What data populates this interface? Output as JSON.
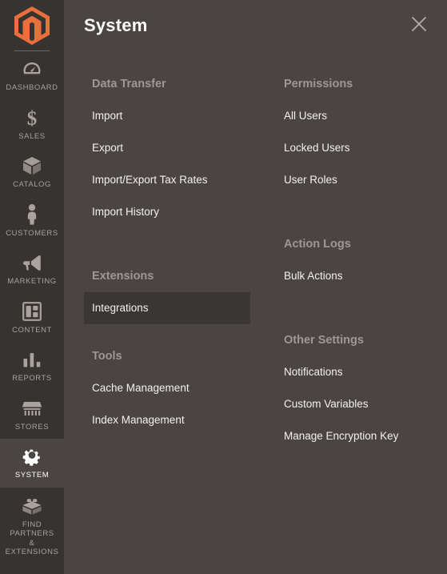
{
  "brand": {
    "logo_icon": "magento-logo-icon",
    "logo_color": "#e9703e"
  },
  "sidebar": {
    "items": [
      {
        "label": "DASHBOARD",
        "icon": "dashboard-gauge-icon",
        "active": false
      },
      {
        "label": "SALES",
        "icon": "dollar-sign-icon",
        "active": false
      },
      {
        "label": "CATALOG",
        "icon": "box-icon",
        "active": false
      },
      {
        "label": "CUSTOMERS",
        "icon": "person-icon",
        "active": false
      },
      {
        "label": "MARKETING",
        "icon": "megaphone-icon",
        "active": false
      },
      {
        "label": "CONTENT",
        "icon": "layout-page-icon",
        "active": false
      },
      {
        "label": "REPORTS",
        "icon": "bar-chart-icon",
        "active": false
      },
      {
        "label": "STORES",
        "icon": "storefront-icon",
        "active": false
      },
      {
        "label": "SYSTEM",
        "icon": "gear-icon",
        "active": true
      },
      {
        "label": "FIND PARTNERS\n& EXTENSIONS",
        "icon": "lego-brick-icon",
        "active": false
      }
    ]
  },
  "panel": {
    "title": "System",
    "close_icon": "close-x-icon",
    "columns": {
      "left": [
        {
          "title": "Data Transfer",
          "items": [
            {
              "label": "Import",
              "highlighted": false
            },
            {
              "label": "Export",
              "highlighted": false
            },
            {
              "label": "Import/Export Tax Rates",
              "highlighted": false
            },
            {
              "label": "Import History",
              "highlighted": false
            }
          ]
        },
        {
          "title": "Extensions",
          "items": [
            {
              "label": "Integrations",
              "highlighted": true
            }
          ]
        },
        {
          "title": "Tools",
          "items": [
            {
              "label": "Cache Management",
              "highlighted": false
            },
            {
              "label": "Index Management",
              "highlighted": false
            }
          ]
        }
      ],
      "right": [
        {
          "title": "Permissions",
          "items": [
            {
              "label": "All Users",
              "highlighted": false
            },
            {
              "label": "Locked Users",
              "highlighted": false
            },
            {
              "label": "User Roles",
              "highlighted": false
            }
          ]
        },
        {
          "title": "Action Logs",
          "items": [
            {
              "label": "Bulk Actions",
              "highlighted": false
            }
          ]
        },
        {
          "title": "Other Settings",
          "items": [
            {
              "label": "Notifications",
              "highlighted": false
            },
            {
              "label": "Custom Variables",
              "highlighted": false
            },
            {
              "label": "Manage Encryption Key",
              "highlighted": false
            }
          ]
        }
      ]
    }
  },
  "colors": {
    "sidebar_bg": "#373330",
    "panel_bg": "#4a4542",
    "highlight_bg": "#3a3633",
    "accent": "#e9703e",
    "group_title": "#9e9894",
    "item_text": "#f2f1f0"
  }
}
